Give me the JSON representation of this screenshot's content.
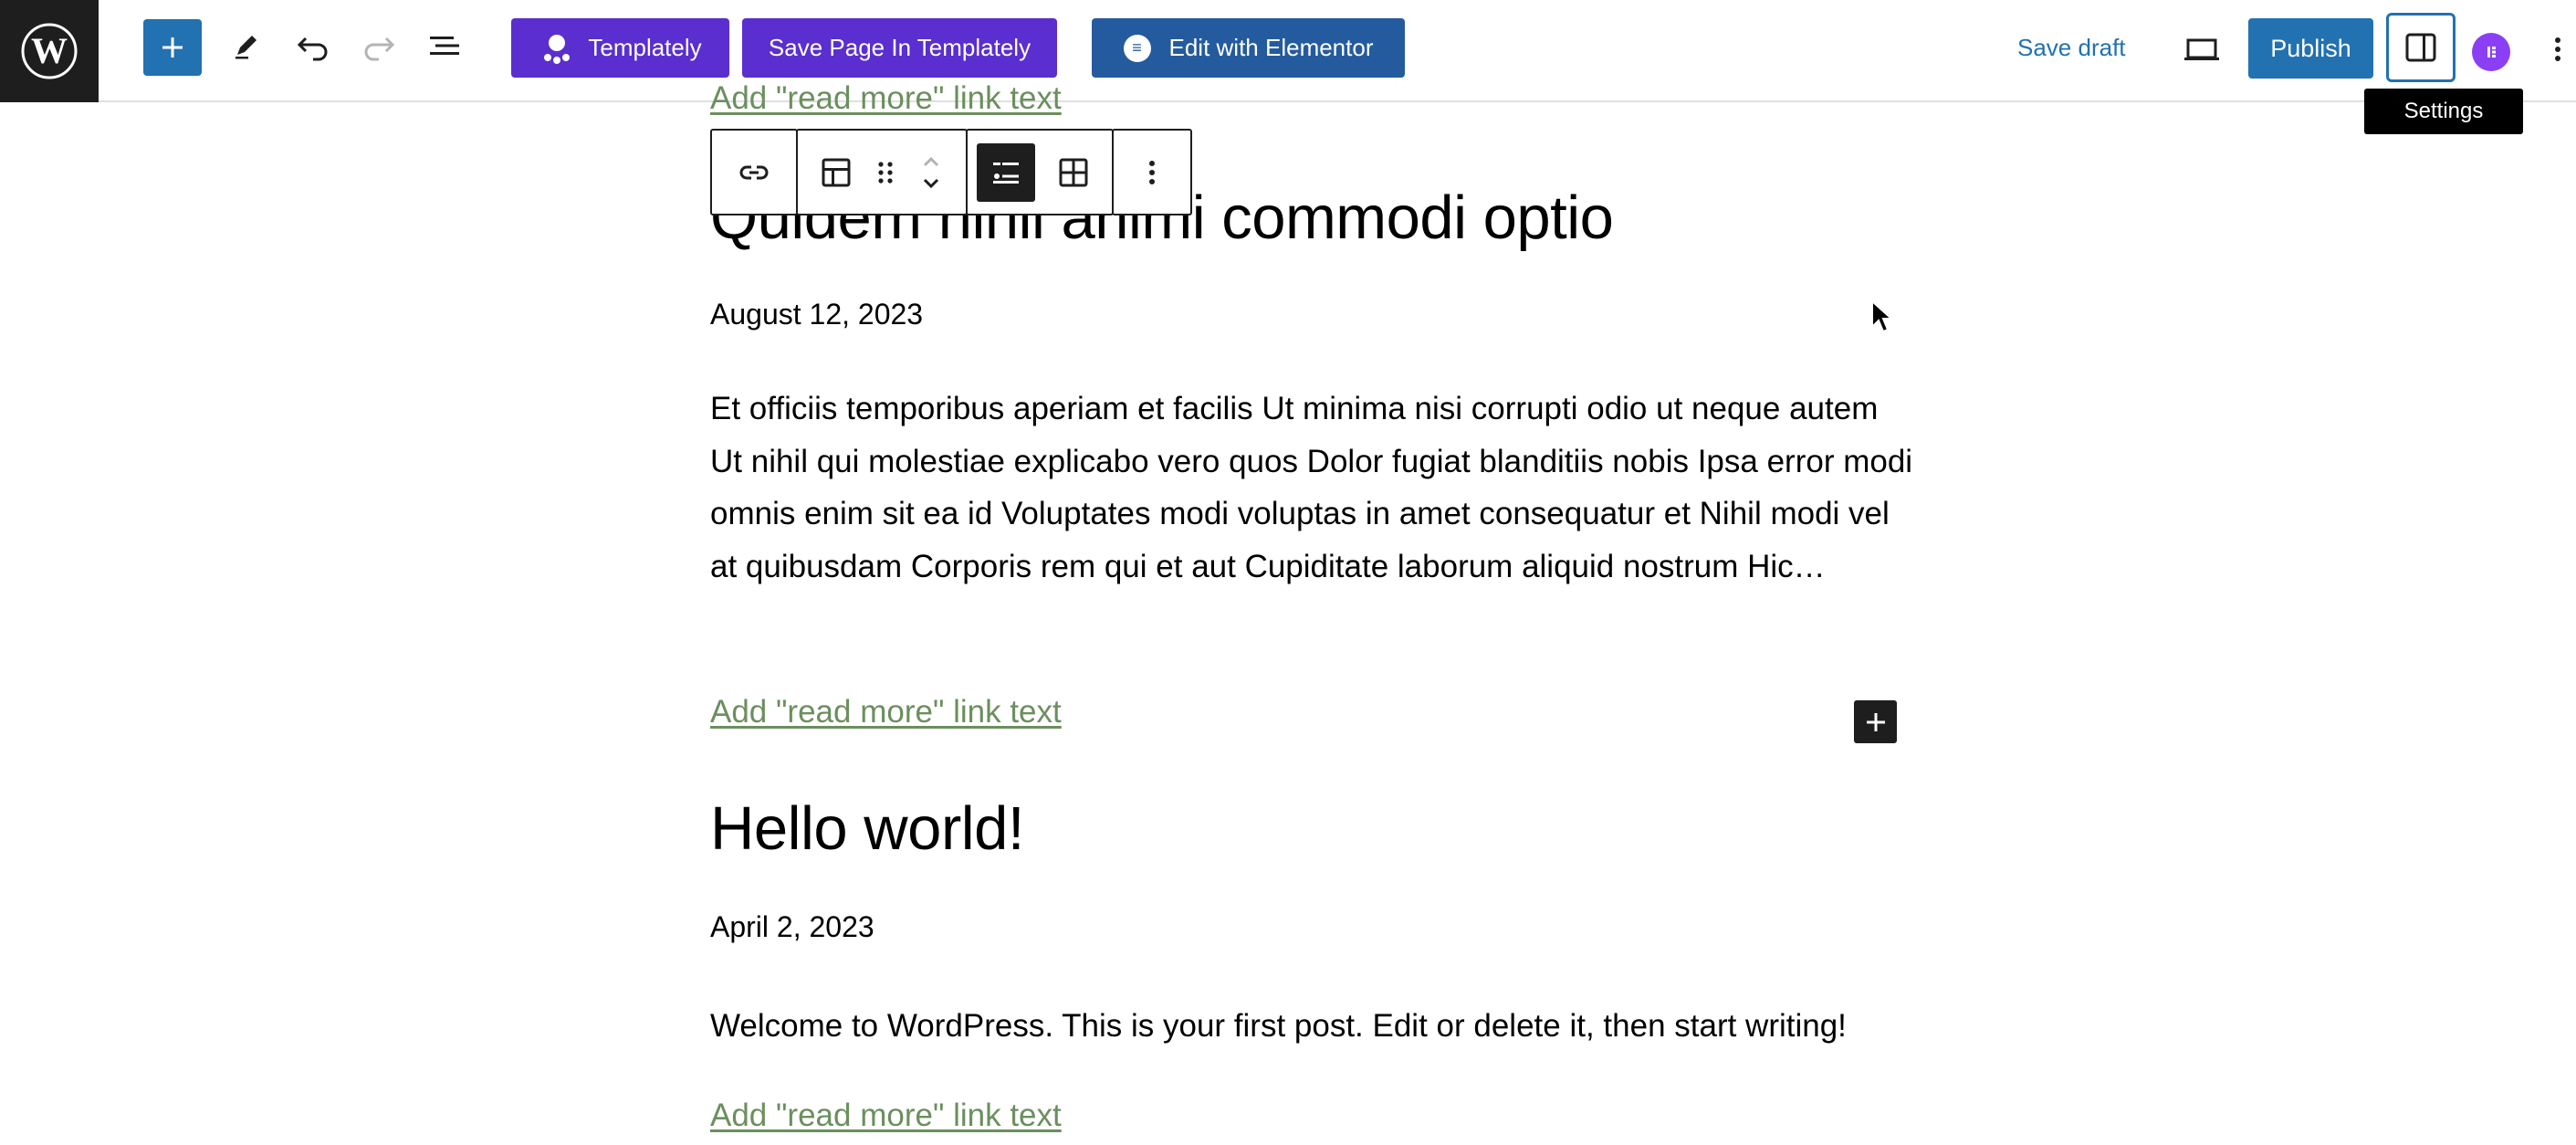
{
  "toolbar": {
    "templately_label": "Templately",
    "save_in_templately_label": "Save Page In Templately",
    "elementor_label": "Edit with Elementor",
    "save_draft_label": "Save draft",
    "publish_label": "Publish",
    "settings_tooltip": "Settings",
    "icons": {
      "logo": "wordpress-logo-icon",
      "inserter": "plus-icon",
      "tools": "pencil-icon",
      "undo": "undo-icon",
      "redo": "redo-icon",
      "list_view": "list-view-icon",
      "preview": "laptop-icon",
      "settings": "sidebar-icon",
      "options": "vertical-ellipsis-icon"
    },
    "accent_color": "#2271b1",
    "templately_color": "#5a2ecf"
  },
  "block_toolbar": {
    "icons": [
      "link-icon",
      "layout-icon",
      "drag-handle-icon",
      "move-up-icon",
      "move-down-icon",
      "list-view-active-icon",
      "grid-view-icon",
      "more-options-icon"
    ]
  },
  "posts": [
    {
      "read_more_top": "Add \"read more\" link text",
      "title": "Quidem nihil animi commodi optio",
      "date": "August 12, 2023",
      "excerpt": "Et officiis temporibus aperiam et facilis Ut minima nisi corrupti odio ut neque autem Ut nihil qui molestiae explicabo vero quos Dolor fugiat blanditiis nobis Ipsa error modi omnis enim sit ea id Voluptates modi voluptas in amet consequatur et Nihil modi vel at quibusdam Corporis rem qui et aut Cupiditate laborum aliquid nostrum Hic…",
      "read_more": "Add \"read more\" link text"
    },
    {
      "title": "Hello world!",
      "date": "April 2, 2023",
      "excerpt": "Welcome to WordPress. This is your first post. Edit or delete it, then start writing!",
      "read_more": "Add \"read more\" link text"
    }
  ]
}
